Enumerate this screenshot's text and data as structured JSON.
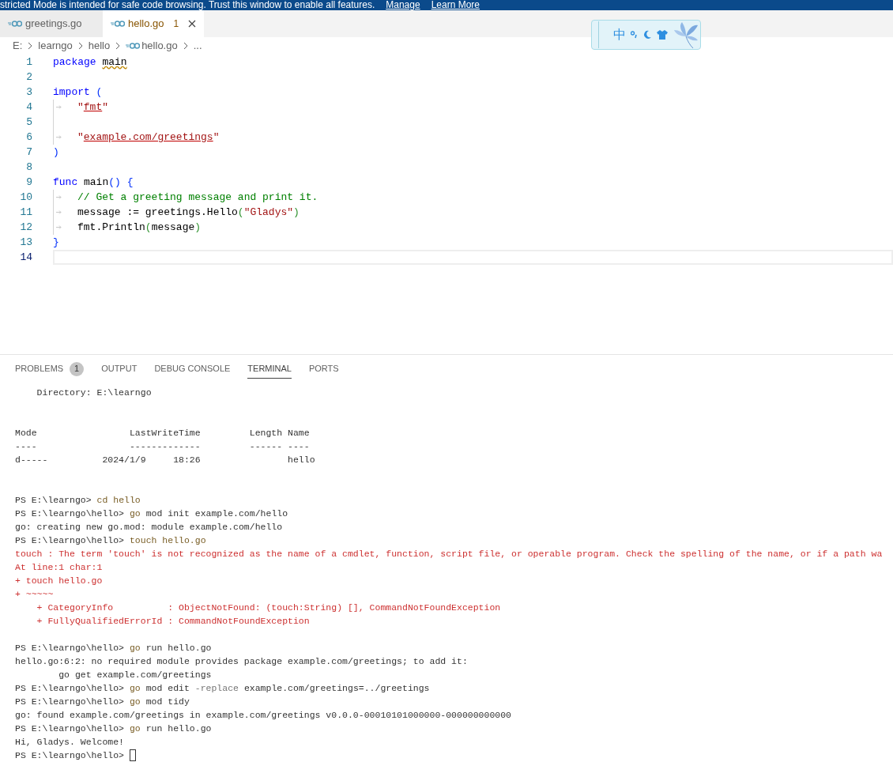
{
  "banner": {
    "text": "stricted Mode is intended for safe code browsing. Trust this window to enable all features.",
    "links": [
      "Manage",
      "Learn More"
    ]
  },
  "editor_tabs": [
    {
      "label": "greetings.go",
      "selected": false
    },
    {
      "label": "hello.go",
      "selected": true,
      "problem_count": "1"
    }
  ],
  "breadcrumb": [
    {
      "label": "E:",
      "kind": "folder"
    },
    {
      "label": "learngo",
      "kind": "folder"
    },
    {
      "label": "hello",
      "kind": "folder"
    },
    {
      "label": "hello.go",
      "kind": "gofile"
    },
    {
      "label": "...",
      "kind": "more"
    }
  ],
  "ime": {
    "mode": "中"
  },
  "code_lines": [
    {
      "number": "1",
      "current": false,
      "tokens": [
        {
          "text": "package ",
          "kind": "keyword"
        },
        {
          "text": "main",
          "kind": "warning"
        }
      ]
    },
    {
      "number": "2",
      "current": false
    },
    {
      "number": "3",
      "current": false,
      "tokens": [
        {
          "text": "import ",
          "kind": "keyword"
        },
        {
          "text": "(",
          "kind": "bracket1"
        }
      ]
    },
    {
      "number": "4",
      "current": false,
      "tokens": [
        {
          "kind": "tab"
        },
        {
          "text": "\"",
          "kind": "string"
        },
        {
          "text": "fmt",
          "kind": "error"
        },
        {
          "text": "\"",
          "kind": "string"
        }
      ]
    },
    {
      "number": "5",
      "current": false,
      "tokens": [
        {
          "kind": "guide"
        }
      ]
    },
    {
      "number": "6",
      "current": false,
      "tokens": [
        {
          "kind": "tab"
        },
        {
          "text": "\"",
          "kind": "string"
        },
        {
          "text": "example.com/greetings",
          "kind": "error"
        },
        {
          "text": "\"",
          "kind": "string"
        }
      ]
    },
    {
      "number": "7",
      "current": false,
      "tokens": [
        {
          "text": ")",
          "kind": "bracket1"
        }
      ]
    },
    {
      "number": "8",
      "current": false
    },
    {
      "number": "9",
      "current": false,
      "tokens": [
        {
          "text": "func ",
          "kind": "keyword"
        },
        {
          "text": "main",
          "kind": "plain"
        },
        {
          "text": "() {",
          "kind": "bracket1"
        }
      ]
    },
    {
      "number": "10",
      "current": false,
      "tokens": [
        {
          "kind": "tab"
        },
        {
          "text": "// Get a greeting message and print it.",
          "kind": "comment"
        }
      ]
    },
    {
      "number": "11",
      "current": false,
      "tokens": [
        {
          "kind": "tab"
        },
        {
          "text": "message := greetings.Hello",
          "kind": "plain"
        },
        {
          "text": "(",
          "kind": "bracket2"
        },
        {
          "text": "\"Gladys\"",
          "kind": "string"
        },
        {
          "text": ")",
          "kind": "bracket2"
        }
      ]
    },
    {
      "number": "12",
      "current": false,
      "tokens": [
        {
          "kind": "tab"
        },
        {
          "text": "fmt.Println",
          "kind": "plain"
        },
        {
          "text": "(",
          "kind": "bracket2"
        },
        {
          "text": "message",
          "kind": "plain"
        },
        {
          "text": ")",
          "kind": "bracket2"
        }
      ]
    },
    {
      "number": "13",
      "current": false,
      "tokens": [
        {
          "text": "}",
          "kind": "bracket1"
        }
      ]
    },
    {
      "number": "14",
      "current": true
    }
  ],
  "panel_tabs": [
    {
      "label": "PROBLEMS",
      "selected": false,
      "badge": "1"
    },
    {
      "label": "OUTPUT",
      "selected": false
    },
    {
      "label": "DEBUG CONSOLE",
      "selected": false
    },
    {
      "label": "TERMINAL",
      "selected": true
    },
    {
      "label": "PORTS",
      "selected": false
    }
  ],
  "terminal_lines": [
    {
      "segments": [
        {
          "text": "    Directory: E:\\learngo",
          "kind": "plain"
        }
      ]
    },
    {
      "kind": "blank"
    },
    {
      "kind": "blank"
    },
    {
      "segments": [
        {
          "text": "Mode                 LastWriteTime         Length Name",
          "kind": "plain"
        }
      ]
    },
    {
      "segments": [
        {
          "text": "----                 -------------         ------ ----",
          "kind": "plain"
        }
      ]
    },
    {
      "segments": [
        {
          "text": "d-----          2024/1/9     18:26                hello",
          "kind": "plain"
        }
      ]
    },
    {
      "kind": "blank"
    },
    {
      "kind": "blank"
    },
    {
      "segments": [
        {
          "text": "PS E:\\learngo> ",
          "kind": "plain"
        },
        {
          "text": "cd hello",
          "kind": "command"
        }
      ]
    },
    {
      "segments": [
        {
          "text": "PS E:\\learngo\\hello> ",
          "kind": "plain"
        },
        {
          "text": "go",
          "kind": "command"
        },
        {
          "text": " mod init example.com/hello",
          "kind": "plain"
        }
      ]
    },
    {
      "segments": [
        {
          "text": "go: creating new go.mod: module example.com/hello",
          "kind": "plain"
        }
      ]
    },
    {
      "segments": [
        {
          "text": "PS E:\\learngo\\hello> ",
          "kind": "plain"
        },
        {
          "text": "touch hello.go",
          "kind": "command"
        }
      ]
    },
    {
      "segments": [
        {
          "text": "touch : The term 'touch' is not recognized as the name of a cmdlet, function, script file, or operable program. Check the spelling of the name, or if a path wa",
          "kind": "error"
        }
      ]
    },
    {
      "segments": [
        {
          "text": "At line:1 char:1",
          "kind": "error"
        }
      ]
    },
    {
      "segments": [
        {
          "text": "+ touch hello.go",
          "kind": "error"
        }
      ]
    },
    {
      "segments": [
        {
          "text": "+ ~~~~~",
          "kind": "error"
        }
      ]
    },
    {
      "segments": [
        {
          "text": "    + CategoryInfo          : ObjectNotFound: (touch:String) [], CommandNotFoundException",
          "kind": "error"
        }
      ]
    },
    {
      "segments": [
        {
          "text": "    + FullyQualifiedErrorId : CommandNotFoundException",
          "kind": "error"
        }
      ]
    },
    {
      "kind": "blank"
    },
    {
      "segments": [
        {
          "text": "PS E:\\learngo\\hello> ",
          "kind": "plain"
        },
        {
          "text": "go",
          "kind": "command"
        },
        {
          "text": " run hello.go",
          "kind": "plain"
        }
      ]
    },
    {
      "segments": [
        {
          "text": "hello.go:6:2: no required module provides package example.com/greetings; to add it:",
          "kind": "plain"
        }
      ]
    },
    {
      "segments": [
        {
          "text": "        go get example.com/greetings",
          "kind": "plain"
        }
      ]
    },
    {
      "segments": [
        {
          "text": "PS E:\\learngo\\hello> ",
          "kind": "plain"
        },
        {
          "text": "go",
          "kind": "command"
        },
        {
          "text": " mod edit ",
          "kind": "plain"
        },
        {
          "text": "-replace",
          "kind": "param"
        },
        {
          "text": " example.com/greetings=../greetings",
          "kind": "plain"
        }
      ]
    },
    {
      "segments": [
        {
          "text": "PS E:\\learngo\\hello> ",
          "kind": "plain"
        },
        {
          "text": "go",
          "kind": "command"
        },
        {
          "text": " mod tidy",
          "kind": "plain"
        }
      ]
    },
    {
      "segments": [
        {
          "text": "go: found example.com/greetings in example.com/greetings v0.0.0-00010101000000-000000000000",
          "kind": "plain"
        }
      ]
    },
    {
      "segments": [
        {
          "text": "PS E:\\learngo\\hello> ",
          "kind": "plain"
        },
        {
          "text": "go",
          "kind": "command"
        },
        {
          "text": " run hello.go",
          "kind": "plain"
        }
      ]
    },
    {
      "segments": [
        {
          "text": "Hi, Gladys. Welcome!",
          "kind": "plain"
        }
      ]
    },
    {
      "segments": [
        {
          "text": "PS E:\\learngo\\hello> ",
          "kind": "plain"
        },
        {
          "kind": "cursor"
        }
      ]
    }
  ]
}
